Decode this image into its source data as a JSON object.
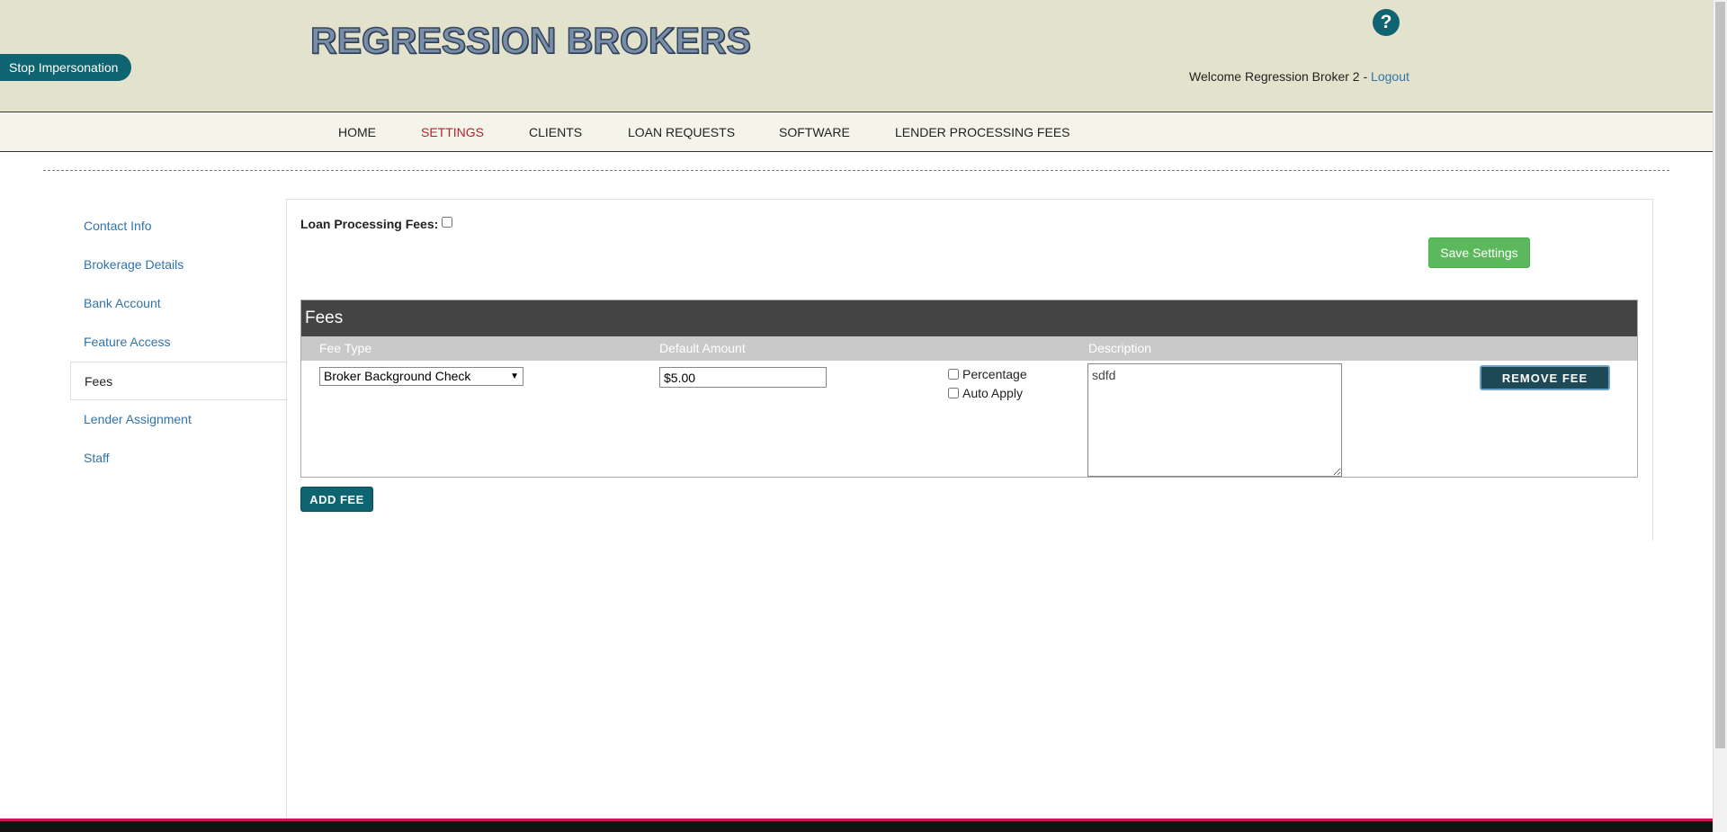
{
  "header": {
    "logo_text": "REGRESSION BROKERS",
    "stop_impersonation": "Stop Impersonation",
    "help_icon": "?",
    "welcome_text": "Welcome Regression Broker 2 - ",
    "logout_label": "Logout"
  },
  "nav": {
    "items": [
      {
        "label": "HOME"
      },
      {
        "label": "SETTINGS",
        "active": true
      },
      {
        "label": "CLIENTS"
      },
      {
        "label": "LOAN REQUESTS"
      },
      {
        "label": "SOFTWARE"
      },
      {
        "label": "LENDER PROCESSING FEES"
      }
    ]
  },
  "sidebar": {
    "items": [
      {
        "label": "Contact Info"
      },
      {
        "label": "Brokerage Details"
      },
      {
        "label": "Bank Account"
      },
      {
        "label": "Feature Access"
      },
      {
        "label": "Fees",
        "active": true
      },
      {
        "label": "Lender Assignment"
      },
      {
        "label": "Staff"
      }
    ]
  },
  "settings": {
    "loan_processing_fees_label": "Loan Processing Fees:",
    "loan_processing_fees_checked": false,
    "save_label": "Save Settings"
  },
  "fees": {
    "title": "Fees",
    "columns": {
      "fee_type": "Fee Type",
      "default_amount": "Default Amount",
      "description": "Description"
    },
    "rows": [
      {
        "fee_type": "Broker Background Check",
        "amount": "$5.00",
        "percentage_label": "Percentage",
        "percentage_checked": false,
        "auto_apply_label": "Auto Apply",
        "auto_apply_checked": false,
        "description": "sdfd",
        "remove_label": "REMOVE FEE"
      }
    ],
    "add_label": "ADD FEE"
  },
  "colors": {
    "header_bg": "#e3e2cc",
    "accent_teal": "#0e6470",
    "active_nav": "#b5202e",
    "link_blue": "#3173a8",
    "save_green": "#5cb85c"
  }
}
